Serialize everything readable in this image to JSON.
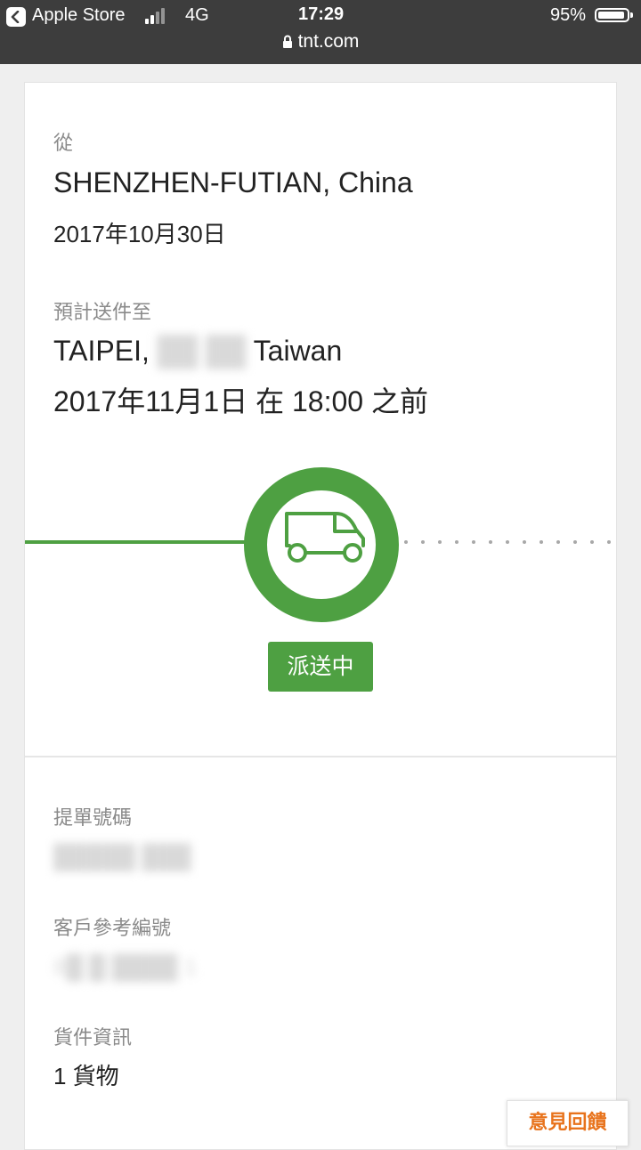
{
  "status_bar": {
    "back_app": "Apple Store",
    "network": "4G",
    "time": "17:29",
    "battery_pct": "95%",
    "battery_level": 0.95,
    "signal_bars_active": 2,
    "url": "tnt.com"
  },
  "shipment": {
    "from_label": "從",
    "from_location": "SHENZHEN-FUTIAN, China",
    "from_date": "2017年10月30日",
    "eta_label": "預計送件至",
    "to_city": "TAIPEI,",
    "to_district": "██ ██",
    "to_country": "Taiwan",
    "to_datetime": "2017年11月1日 在 18:00 之前",
    "status_label": "派送中",
    "status_icon": "delivery-truck-icon",
    "accent_color": "#4ea042"
  },
  "details": {
    "waybill_label": "提單號碼",
    "waybill_value": "█████ ███",
    "customer_ref_label": "客戶參考編號",
    "customer_ref_value": "8█ █ ████ 1",
    "shipment_info_label": "貨件資訊",
    "shipment_info_value": "1 貨物"
  },
  "feedback_button": "意見回饋"
}
